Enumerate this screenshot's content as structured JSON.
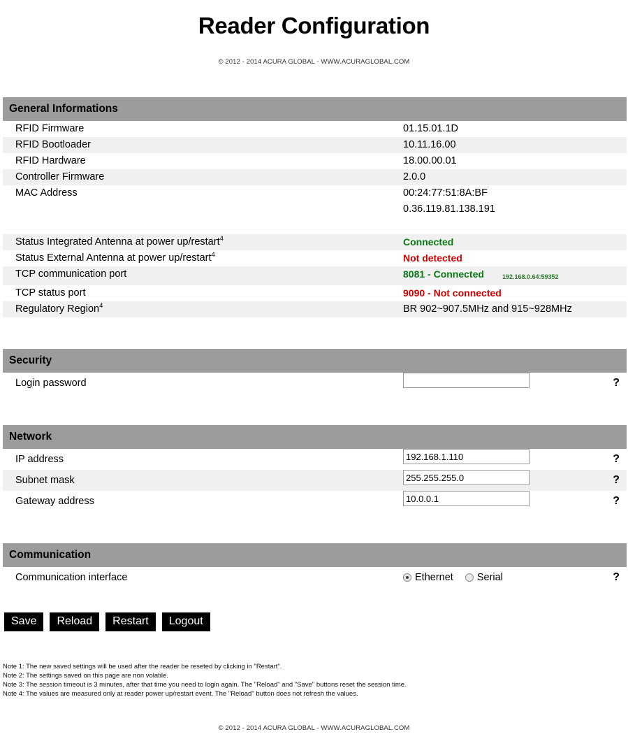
{
  "page": {
    "title": "Reader Configuration",
    "top_copyright": "© 2012 - 2014 ACURA GLOBAL - WWW.ACURAGLOBAL.COM",
    "bottom_copyright": "© 2012 - 2014 ACURA GLOBAL - WWW.ACURAGLOBAL.COM"
  },
  "colors": {
    "section_header_bg": "#9c9c9c",
    "stripe_bg": "#f0f0f0",
    "status_ok": "#0a7a14",
    "status_bad": "#d10000",
    "button_bg": "#000000"
  },
  "general": {
    "header": "General Informations",
    "rows": [
      {
        "label": "RFID Firmware",
        "value": "01.15.01.1D"
      },
      {
        "label": "RFID Bootloader",
        "value": "10.11.16.00"
      },
      {
        "label": "RFID Hardware",
        "value": "18.00.00.01"
      },
      {
        "label": "Controller Firmware",
        "value": "2.0.0"
      },
      {
        "label": "MAC Address",
        "value": "00:24:77:51:8A:BF",
        "value2": "0.36.119.81.138.191"
      },
      {
        "label": "Status Integrated Antenna at power up/restart",
        "sup": "4",
        "value": "Connected",
        "status": "ok"
      },
      {
        "label": "Status External Antenna at power up/restart",
        "sup": "4",
        "value": "Not detected",
        "status": "bad"
      },
      {
        "label": "TCP communication port",
        "value": "8081 - Connected",
        "status": "ok",
        "note": "192.168.0.64:59352"
      },
      {
        "label": "TCP status port",
        "value": "9090 - Not connected",
        "status": "bad"
      },
      {
        "label": "Regulatory Region",
        "sup": "4",
        "value": "BR 902~907.5MHz and 915~928MHz"
      }
    ]
  },
  "security": {
    "header": "Security",
    "rows": [
      {
        "label": "Login password",
        "value": "",
        "placeholder": "",
        "help": "?"
      }
    ]
  },
  "network": {
    "header": "Network",
    "rows": [
      {
        "label": "IP address",
        "value": "192.168.1.110",
        "placeholder": "",
        "help": "?"
      },
      {
        "label": "Subnet mask",
        "value": "255.255.255.0",
        "placeholder": "",
        "help": "?"
      },
      {
        "label": "Gateway address",
        "value": "10.0.0.1",
        "placeholder": "",
        "help": "?"
      }
    ]
  },
  "communication": {
    "header": "Communication",
    "row_label": "Communication interface",
    "help": "?",
    "options": [
      {
        "label": "Ethernet",
        "selected": true
      },
      {
        "label": "Serial",
        "selected": false
      }
    ]
  },
  "buttons": [
    {
      "label": "Save"
    },
    {
      "label": "Reload"
    },
    {
      "label": "Restart"
    },
    {
      "label": "Logout"
    }
  ],
  "notes": [
    "Note 1: The new saved settings will be used after the reader be reseted by clicking in \"Restart\".",
    "Note 2: The settings saved on this page are non volatile.",
    "Note 3: The session timeout is 3 minutes, after that time you need to login again. The \"Reload\" and \"Save\" buttons reset the session time.",
    "Note 4: The values are measured only at reader power up/restart event. The \"Reload\" button does not refresh the values."
  ]
}
